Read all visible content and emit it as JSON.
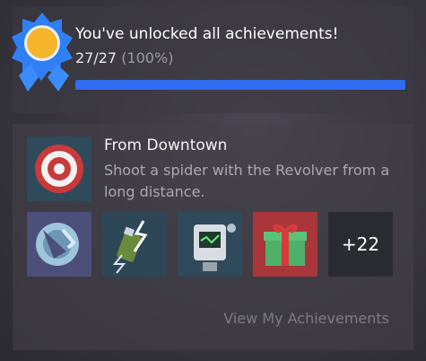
{
  "summary": {
    "title": "You've unlocked all achievements!",
    "count": "27/27",
    "percent": "(100%)",
    "progress_fraction": 1.0
  },
  "featured": {
    "name": "From Downtown",
    "description": "Shoot a spider with the Revolver from a long distance.",
    "icon": "target-icon"
  },
  "thumbnails": [
    {
      "icon": "broken-shield-icon"
    },
    {
      "icon": "lightning-battery-icon"
    },
    {
      "icon": "robot-icon"
    },
    {
      "icon": "gift-icon"
    }
  ],
  "more_count": "+22",
  "view_link": "View My Achievements",
  "colors": {
    "progress": "#2f6cf0",
    "badge_blue": "#2f80ff",
    "badge_gold": "#f5b324"
  }
}
